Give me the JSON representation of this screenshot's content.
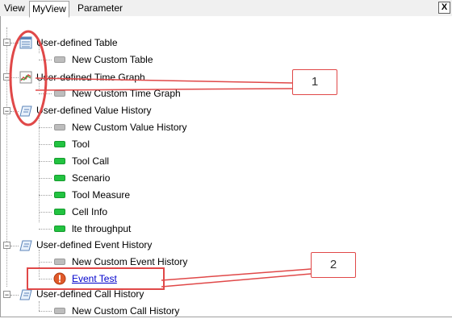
{
  "tabs": [
    {
      "label": "View"
    },
    {
      "label": "MyView"
    },
    {
      "label": "Parameter"
    }
  ],
  "close_label": "X",
  "tree": {
    "table": {
      "label": "User-defined Table",
      "children": [
        "New Custom Table"
      ]
    },
    "time_graph": {
      "label": "User-defined Time Graph",
      "children": [
        "New Custom Time Graph"
      ]
    },
    "value_history": {
      "label": "User-defined Value History",
      "children": [
        "New Custom Value History",
        "Tool",
        "Tool Call",
        "Scenario",
        "Tool Measure",
        "Cell Info",
        "lte throughput"
      ]
    },
    "event_history": {
      "label": "User-defined Event History",
      "children": [
        "New Custom Event History",
        "Event Test"
      ]
    },
    "call_history": {
      "label": "User-defined Call History",
      "children": [
        "New Custom Call History"
      ]
    }
  },
  "callouts": [
    "1",
    "2"
  ],
  "colors": {
    "annotation": "#e04848",
    "active_item": "#22c341",
    "link": "#0000cc"
  }
}
